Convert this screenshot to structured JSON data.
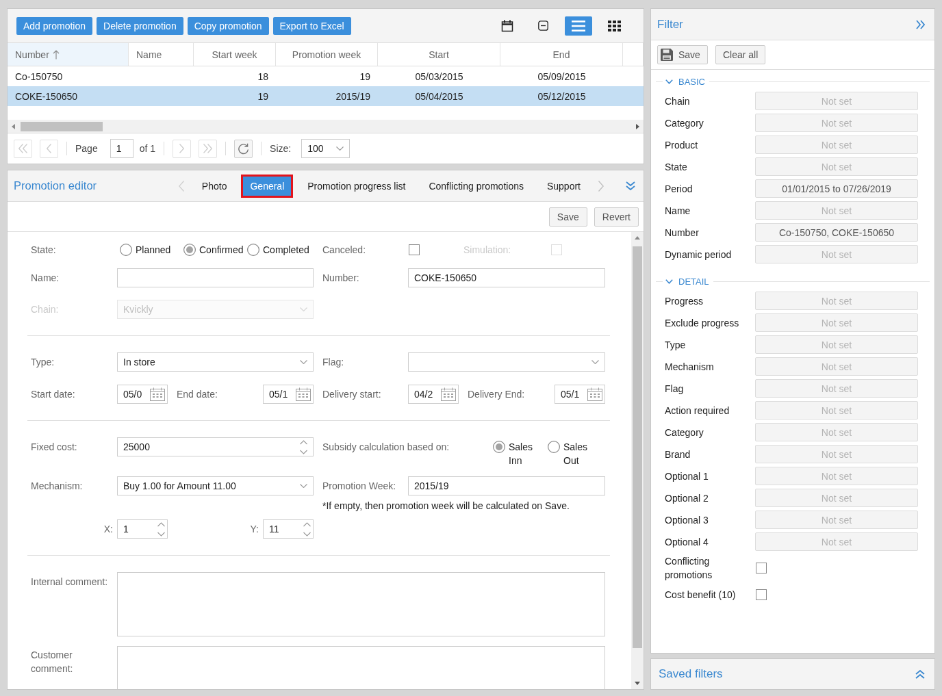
{
  "grid_toolbar": {
    "buttons": [
      "Add promotion",
      "Delete promotion",
      "Copy promotion",
      "Export to Excel"
    ],
    "view_buttons": [
      {
        "kind": "calendar",
        "selected": false
      },
      {
        "kind": "collapse",
        "selected": false
      },
      {
        "kind": "list",
        "selected": true
      },
      {
        "kind": "grid",
        "selected": false
      }
    ]
  },
  "table": {
    "columns": [
      {
        "label": "Number",
        "sorted": true
      },
      {
        "label": "Name",
        "sorted": false
      },
      {
        "label": "Start week",
        "sorted": false
      },
      {
        "label": "Promotion week",
        "sorted": false
      },
      {
        "label": "Start",
        "sorted": false
      },
      {
        "label": "End",
        "sorted": false
      }
    ],
    "rows": [
      {
        "selected": false,
        "number": "Co-150750",
        "start_week": "18",
        "promotion_week": "19",
        "start": "05/03/2015",
        "end": "05/09/2015"
      },
      {
        "selected": true,
        "number": "COKE-150650",
        "start_week": "19",
        "promotion_week": "2015/19",
        "start": "05/04/2015",
        "end": "05/12/2015"
      }
    ]
  },
  "pager": {
    "buttons": [
      {
        "kind": "first",
        "disabled": true
      },
      {
        "kind": "previous",
        "disabled": true
      },
      {
        "kind": "next",
        "disabled": true
      },
      {
        "kind": "last",
        "disabled": true
      },
      {
        "kind": "refresh",
        "disabled": false
      }
    ],
    "page_label": "Page",
    "page": "1",
    "page_count": "of 1",
    "size_label": "Size:",
    "size": "100"
  },
  "editor": {
    "title": "Promotion editor",
    "tabs": [
      {
        "label": "Photo",
        "selected": false,
        "highlighted": false
      },
      {
        "label": "General",
        "selected": true,
        "highlighted": true
      },
      {
        "label": "Promotion progress list",
        "selected": false,
        "highlighted": false
      },
      {
        "label": "Conflicting promotions",
        "selected": false,
        "highlighted": false
      },
      {
        "label": "Support",
        "selected": false,
        "highlighted": false
      }
    ],
    "actions": [
      "Save",
      "Revert"
    ],
    "form": {
      "state": {
        "label": "State:",
        "options": [
          {
            "label": "Planned",
            "selected": false
          },
          {
            "label": "Confirmed",
            "selected": true
          },
          {
            "label": "Completed",
            "selected": false
          }
        ]
      },
      "canceled": {
        "label": "Canceled:",
        "checked": false,
        "disabled": false
      },
      "simulation": {
        "label": "Simulation:",
        "checked": false,
        "disabled": true
      },
      "name": {
        "label": "Name:"
      },
      "number": {
        "label": "Number:",
        "value": "COKE-150650"
      },
      "chain": {
        "label": "Chain:",
        "value": "Kvickly",
        "disabled": true
      },
      "type": {
        "label": "Type:",
        "value": "In store"
      },
      "flag": {
        "label": "Flag:"
      },
      "start_date": {
        "label": "Start date:",
        "value": "05/0"
      },
      "end_date": {
        "label": "End date:",
        "value": "05/1"
      },
      "delivery_start": {
        "label": "Delivery start:",
        "value": "04/2"
      },
      "delivery_end": {
        "label": "Delivery End:",
        "value": "05/1"
      },
      "fixed_cost": {
        "label": "Fixed cost:",
        "value": "25000"
      },
      "subsidy": {
        "label": "Subsidy calculation based on:",
        "options": [
          {
            "label": "Sales Inn",
            "selected": true
          },
          {
            "label": "Sales Out",
            "selected": false
          }
        ]
      },
      "mechanism": {
        "label": "Mechanism:",
        "value": "Buy 1.00 for Amount 11.00"
      },
      "promotion_week": {
        "label": "Promotion Week:",
        "value": "2015/19",
        "note": "*If empty, then promotion week will be calculated on Save."
      },
      "x": {
        "label": "X:",
        "value": "1"
      },
      "y": {
        "label": "Y:",
        "value": "11"
      },
      "internal_comment": {
        "label": "Internal comment:"
      },
      "customer_comment": {
        "label": "Customer comment:"
      }
    }
  },
  "filter": {
    "title": "Filter",
    "actions": [
      {
        "kind": "save",
        "label": "Save"
      },
      {
        "kind": "clear",
        "label": "Clear all"
      }
    ],
    "sections": [
      {
        "title": "BASIC",
        "expanded": true,
        "items": [
          {
            "kind": "select",
            "label": "Chain",
            "placeholder": "Not set"
          },
          {
            "kind": "select",
            "label": "Category",
            "placeholder": "Not set"
          },
          {
            "kind": "select",
            "label": "Product",
            "placeholder": "Not set"
          },
          {
            "kind": "select",
            "label": "State",
            "placeholder": "Not set"
          },
          {
            "kind": "select",
            "label": "Period",
            "value": "01/01/2015 to 07/26/2019"
          },
          {
            "kind": "select",
            "label": "Name",
            "placeholder": "Not set"
          },
          {
            "kind": "select",
            "label": "Number",
            "value": "Co-150750, COKE-150650"
          },
          {
            "kind": "select",
            "label": "Dynamic period",
            "placeholder": "Not set"
          }
        ]
      },
      {
        "title": "DETAIL",
        "expanded": true,
        "items": [
          {
            "kind": "select",
            "label": "Progress",
            "placeholder": "Not set"
          },
          {
            "kind": "select",
            "label": "Exclude progress",
            "placeholder": "Not set"
          },
          {
            "kind": "select",
            "label": "Type",
            "placeholder": "Not set"
          },
          {
            "kind": "select",
            "label": "Mechanism",
            "placeholder": "Not set"
          },
          {
            "kind": "select",
            "label": "Flag",
            "placeholder": "Not set"
          },
          {
            "kind": "select",
            "label": "Action required",
            "placeholder": "Not set"
          },
          {
            "kind": "select",
            "label": "Category",
            "placeholder": "Not set"
          },
          {
            "kind": "select",
            "label": "Brand",
            "placeholder": "Not set"
          },
          {
            "kind": "select",
            "label": "Optional 1",
            "placeholder": "Not set"
          },
          {
            "kind": "select",
            "label": "Optional 2",
            "placeholder": "Not set"
          },
          {
            "kind": "select",
            "label": "Optional 3",
            "placeholder": "Not set"
          },
          {
            "kind": "select",
            "label": "Optional 4",
            "placeholder": "Not set"
          },
          {
            "kind": "checkbox",
            "label": "Conflicting promotions",
            "checked": false
          },
          {
            "kind": "checkbox",
            "label": "Cost benefit (10)",
            "checked": false
          }
        ]
      }
    ]
  },
  "saved_filters": {
    "title": "Saved filters"
  }
}
